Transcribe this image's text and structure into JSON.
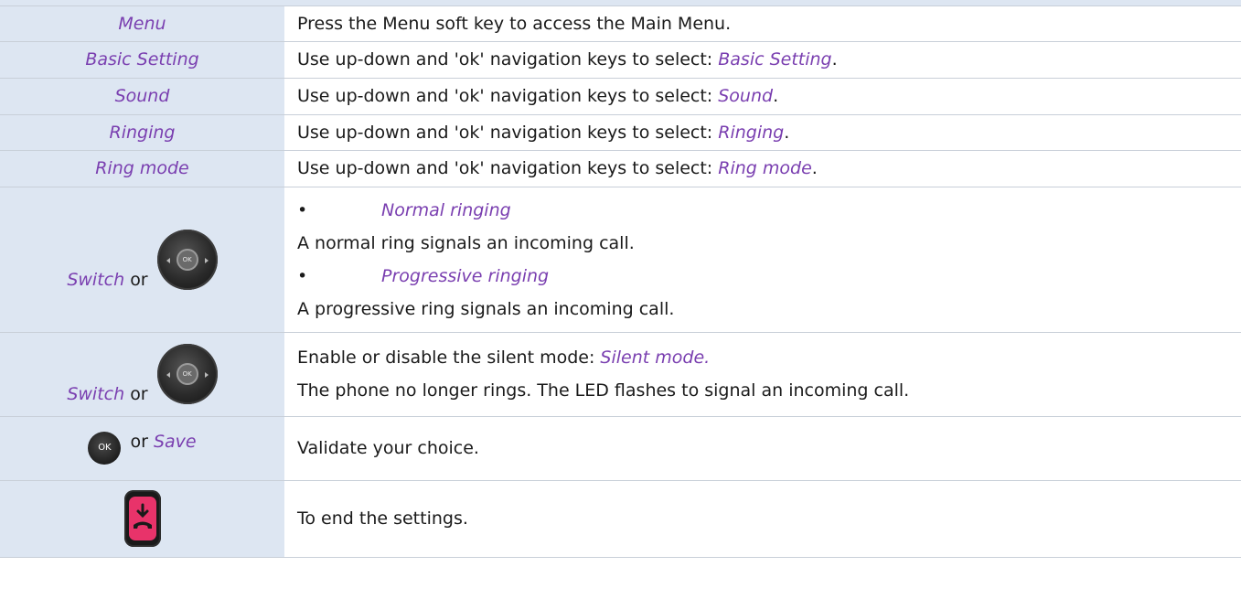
{
  "rows": [
    {
      "key": "Menu",
      "desc": "Press the Menu soft key to access the Main Menu."
    },
    {
      "key": "Basic Setting",
      "desc_prefix": "Use up-down and 'ok' navigation keys to select: ",
      "desc_hl": "Basic Setting",
      "desc_suffix": "."
    },
    {
      "key": "Sound",
      "desc_prefix": "Use up-down and 'ok' navigation keys to select: ",
      "desc_hl": "Sound",
      "desc_suffix": "."
    },
    {
      "key": "Ringing",
      "desc_prefix": "Use up-down and 'ok' navigation keys to select: ",
      "desc_hl": "Ringing",
      "desc_suffix": "."
    },
    {
      "key": "Ring mode",
      "desc_prefix": "Use up-down and 'ok' navigation keys to select: ",
      "desc_hl": "Ring mode",
      "desc_suffix": "."
    }
  ],
  "switch_row": {
    "key_text": "Switch",
    "key_or": "or",
    "bullet": "•",
    "option1": "Normal ringing",
    "option1_desc": "A normal ring signals an incoming call.",
    "option2": "Progressive ringing",
    "option2_desc": "A progressive ring signals an incoming call."
  },
  "silent_row": {
    "key_text": "Switch",
    "key_or": "or",
    "line1_prefix": "Enable or disable the silent mode: ",
    "line1_hl": "Silent mode.",
    "line2": "The phone no longer rings. The LED flashes to signal an incoming call."
  },
  "save_row": {
    "ok_label": "OK",
    "key_or": "or",
    "key_text": "Save",
    "desc": "Validate your choice."
  },
  "end_row": {
    "desc": "To end the settings."
  },
  "icons": {
    "nav_ok_label": "OK",
    "hangup_color": "#e8336a"
  },
  "colors": {
    "accent": "#7a3fb0",
    "key_bg": "#dde6f2",
    "border": "#c8cfd8"
  }
}
